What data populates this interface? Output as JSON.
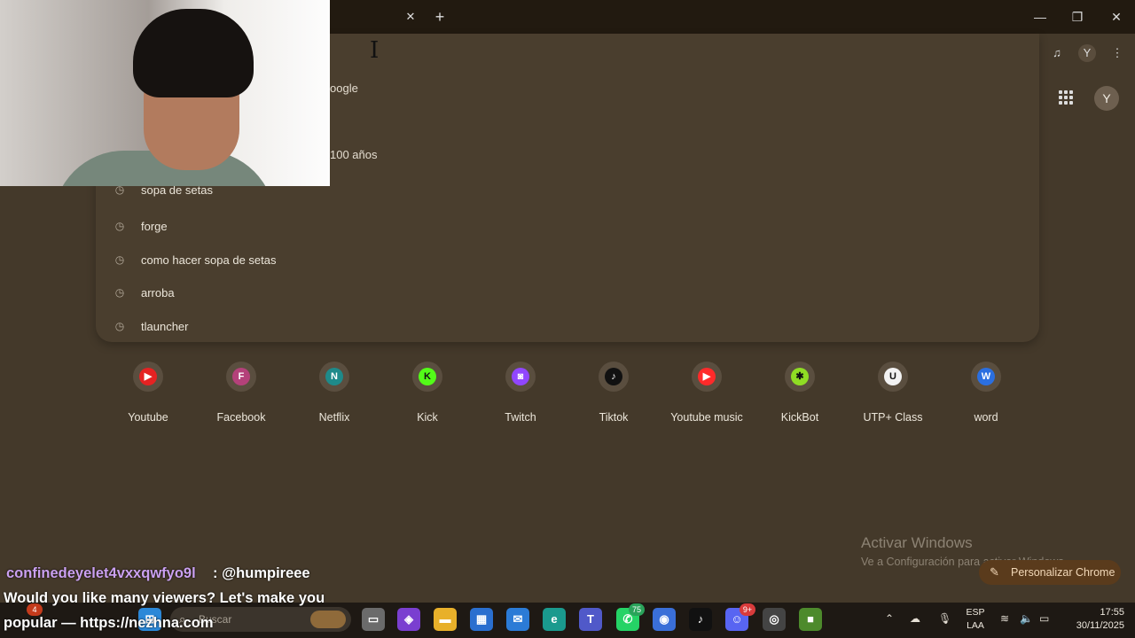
{
  "browser": {
    "tab_close": "✕",
    "new_tab": "+",
    "window_controls": {
      "minimize": "—",
      "restore": "❐",
      "close": "✕"
    },
    "toolbar_icons": [
      "media-control-icon",
      "profile-icon",
      "menu-icon"
    ],
    "profile_initial": "Y"
  },
  "omnibox": {
    "partial_suggestions": [
      "oogle",
      "100 años",
      "sopa de setas"
    ],
    "history_suggestions": [
      "forge",
      "como hacer sopa de setas",
      "arroba",
      "tlauncher"
    ]
  },
  "ntp": {
    "apps_icon": "apps-grid-icon",
    "avatar_initial": "Y",
    "shortcuts": [
      {
        "label": "Youtube",
        "glyph": "▶",
        "color": "#e52222"
      },
      {
        "label": "Facebook",
        "glyph": "F",
        "color": "#b4417a"
      },
      {
        "label": "Netflix",
        "glyph": "N",
        "color": "#1e8a8a"
      },
      {
        "label": "Kick",
        "glyph": "K",
        "color": "#53fc18"
      },
      {
        "label": "Twitch",
        "glyph": "◙",
        "color": "#9146ff"
      },
      {
        "label": "Tiktok",
        "glyph": "♪",
        "color": "#111111"
      },
      {
        "label": "Youtube music",
        "glyph": "▶",
        "color": "#ff2a2a"
      },
      {
        "label": "KickBot",
        "glyph": "✱",
        "color": "#8fdc24"
      },
      {
        "label": "UTP+ Class",
        "glyph": "U",
        "color": "#f2f2f2"
      },
      {
        "label": "word",
        "glyph": "W",
        "color": "#2b6fe0"
      }
    ],
    "personalize_label": "Personalizar Chrome",
    "personalize_icon": "✎"
  },
  "watermark": {
    "line1": "Activar Windows",
    "line2": "Ve a Configuración para activar Windows."
  },
  "chat": {
    "username": "confinedeyelet4vxxqwfyo9l",
    "separator": ": @humpireee",
    "line1": "Would you like many viewers? Let's make you",
    "line2": "popular — https://nezhna.com"
  },
  "taskbar": {
    "search_placeholder": "Buscar",
    "badge_notifications": "4",
    "badge_whatsapp": "75",
    "badge_discord": "9+",
    "lang_line1": "ESP",
    "lang_line2": "LAA",
    "time": "17:55",
    "date": "30/11/2025"
  }
}
